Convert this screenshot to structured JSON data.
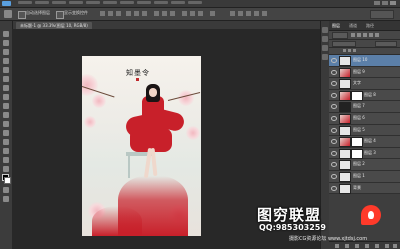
{
  "app": {
    "name": "Photoshop",
    "logo_text": "Ps"
  },
  "options_bar": {
    "auto_select_label": "自动选择",
    "auto_select_target": "图层",
    "show_transform_label": "显示变换控件"
  },
  "document": {
    "tab_label": "未标题-1 @ 33.3%(图层 10, RGB/8)"
  },
  "artwork": {
    "calligraphy": "知墨令"
  },
  "layers_panel": {
    "tabs": [
      "图层",
      "通道",
      "路径"
    ],
    "active_tab": "图层",
    "filter_label": "类型",
    "blend_mode": "正常",
    "opacity_label": "不透明度",
    "lock_label": "锁定",
    "fill_label": "填充",
    "layers": [
      {
        "name": "图层 10",
        "selected": true,
        "thumb": "light",
        "mask": false
      },
      {
        "name": "图层 9",
        "selected": false,
        "thumb": "pic",
        "mask": false
      },
      {
        "name": "文字",
        "selected": false,
        "thumb": "light",
        "mask": false
      },
      {
        "name": "图层 8",
        "selected": false,
        "thumb": "pic",
        "mask": true
      },
      {
        "name": "图层 7",
        "selected": false,
        "thumb": "dark",
        "mask": false
      },
      {
        "name": "图层 6",
        "selected": false,
        "thumb": "pic",
        "mask": false
      },
      {
        "name": "图层 5",
        "selected": false,
        "thumb": "light",
        "mask": false
      },
      {
        "name": "图层 4",
        "selected": false,
        "thumb": "pic",
        "mask": true
      },
      {
        "name": "图层 3",
        "selected": false,
        "thumb": "light",
        "mask": true
      },
      {
        "name": "图层 2",
        "selected": false,
        "thumb": "light",
        "mask": false
      },
      {
        "name": "图层 1",
        "selected": false,
        "thumb": "light",
        "mask": false
      },
      {
        "name": "背景",
        "selected": false,
        "thumb": "light",
        "mask": false
      }
    ]
  },
  "watermark": {
    "title": "图穷联盟",
    "qq": "QQ:985303259",
    "site": "摄影CG资源论坛 www.xjtdsj.com"
  },
  "colors": {
    "selection": "#5b7fa8",
    "accent_red": "#c8202a",
    "flame": "#ff3a2a"
  }
}
